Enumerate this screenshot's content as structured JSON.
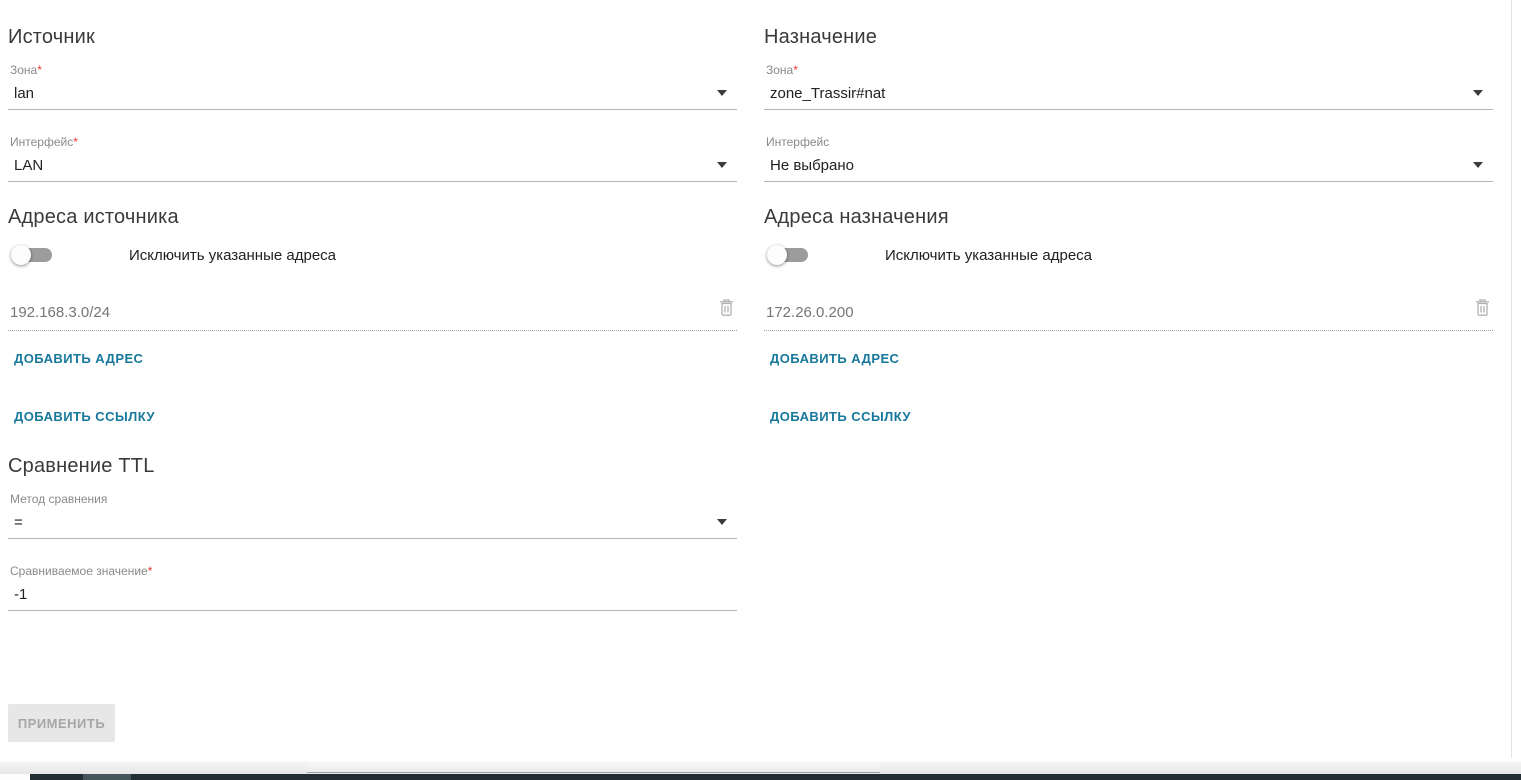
{
  "source": {
    "title": "Источник",
    "zone": {
      "label": "Зона",
      "required": "*",
      "value": "lan"
    },
    "interface": {
      "label": "Интерфейс",
      "required": "*",
      "value": "LAN"
    },
    "addresses": {
      "title": "Адреса источника",
      "toggle_label": "Исключить указанные адреса",
      "toggle_state": "off",
      "address": "192.168.3.0/24",
      "add_address_label": "ДОБАВИТЬ АДРЕС",
      "add_link_label": "ДОБАВИТЬ ССЫЛКУ"
    }
  },
  "destination": {
    "title": "Назначение",
    "zone": {
      "label": "Зона",
      "required": "*",
      "value": "zone_Trassir#nat"
    },
    "interface": {
      "label": "Интерфейс",
      "required": "",
      "value": "Не выбрано"
    },
    "addresses": {
      "title": "Адреса назначения",
      "toggle_label": "Исключить указанные адреса",
      "toggle_state": "off",
      "address": "172.26.0.200",
      "add_address_label": "ДОБАВИТЬ АДРЕС",
      "add_link_label": "ДОБАВИТЬ ССЫЛКУ"
    }
  },
  "ttl": {
    "title": "Сравнение TTL",
    "method": {
      "label": "Метод сравнения",
      "required": "",
      "value": "="
    },
    "compare_value": {
      "label": "Сравниваемое значение",
      "required": "*",
      "value": "-1"
    }
  },
  "apply_button_label": "ПРИМЕНИТЬ",
  "icons": {
    "dropdown": "chevron-down",
    "delete": "trash"
  },
  "colors": {
    "accent": "#17789c",
    "required": "#e53935",
    "label": "#8a8a8a",
    "value": "#212121",
    "disabled_text": "#a6a6a6"
  }
}
